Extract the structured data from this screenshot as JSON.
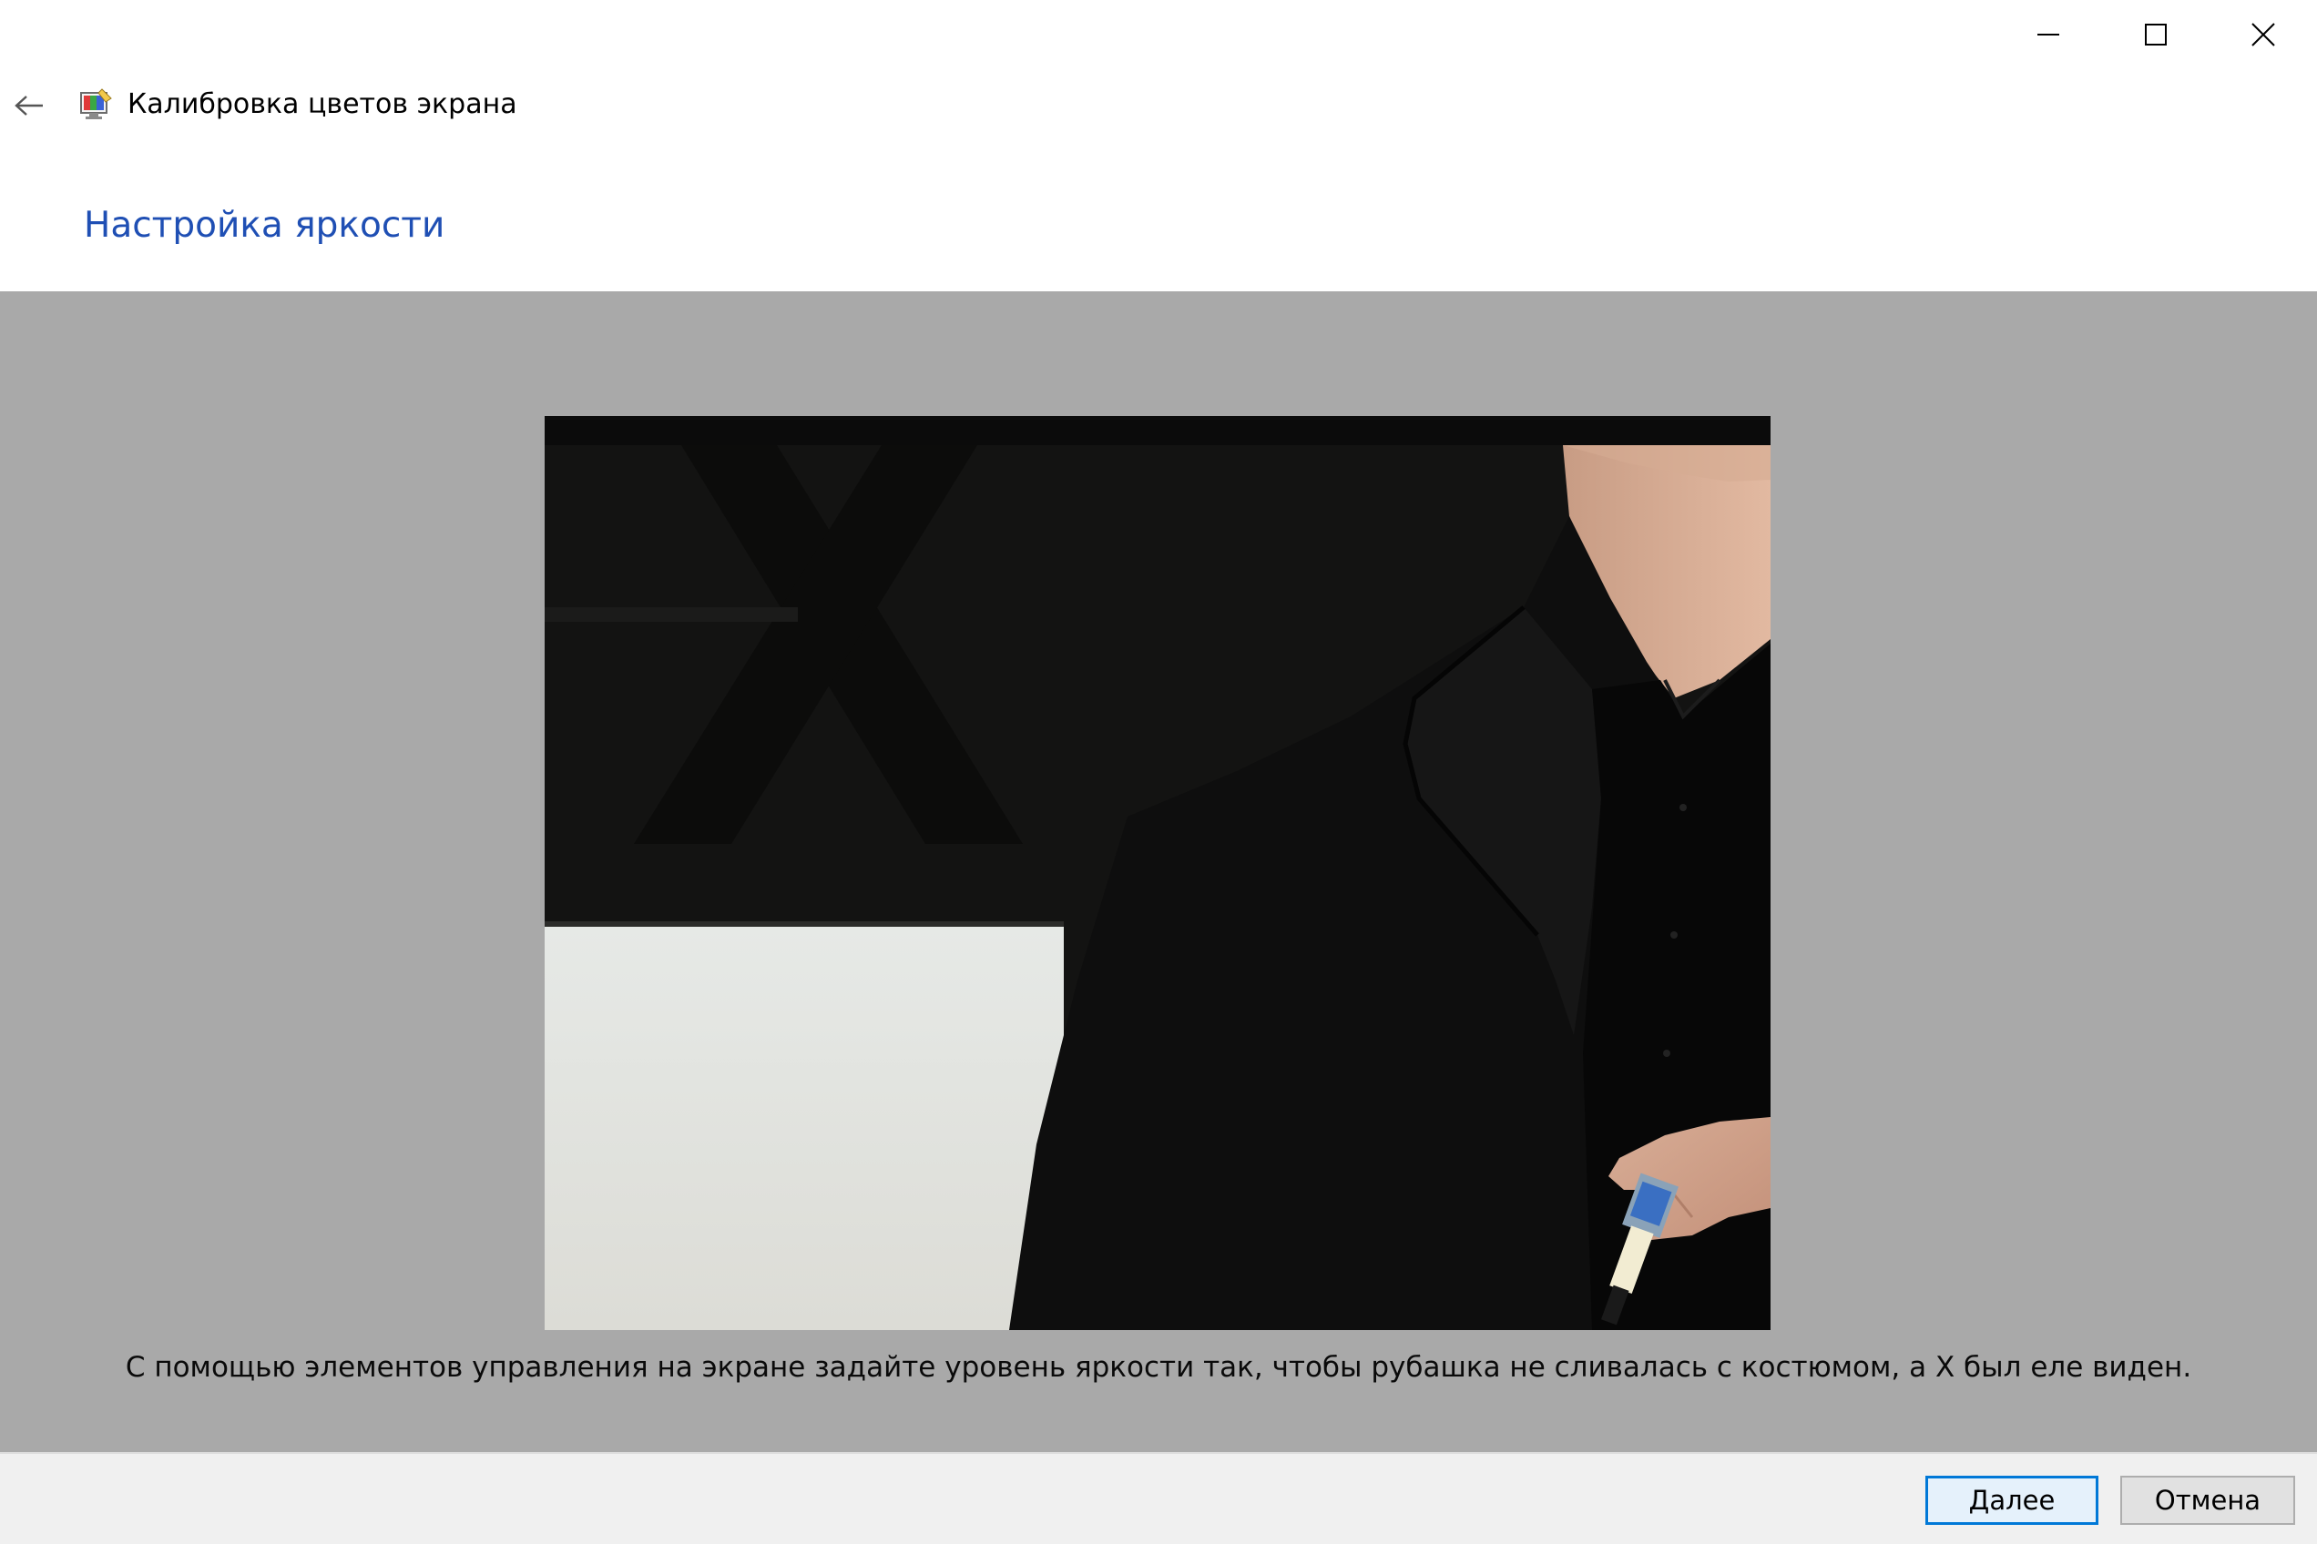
{
  "window": {
    "title": "Калибровка цветов экрана",
    "controls": {
      "minimize_icon": "minimize-icon",
      "maximize_icon": "maximize-icon",
      "close_icon": "close-icon"
    }
  },
  "header": {
    "back_icon": "back-arrow-icon",
    "app_icon": "display-color-calibration-icon",
    "heading": "Настройка яркости"
  },
  "content": {
    "image_description_icon": "brightness-calibration-sample-image",
    "instruction": "С помощью элементов управления на экране задайте уровень яркости так, чтобы рубашка не сливалась с костюмом, а X был еле виден."
  },
  "footer": {
    "next_label": "Далее",
    "cancel_label": "Отмена"
  },
  "colors": {
    "heading": "#1f4fb4",
    "panel_background": "#a9a9a9",
    "footer_background": "#f0f0f0",
    "default_button_border": "#0078d7"
  }
}
